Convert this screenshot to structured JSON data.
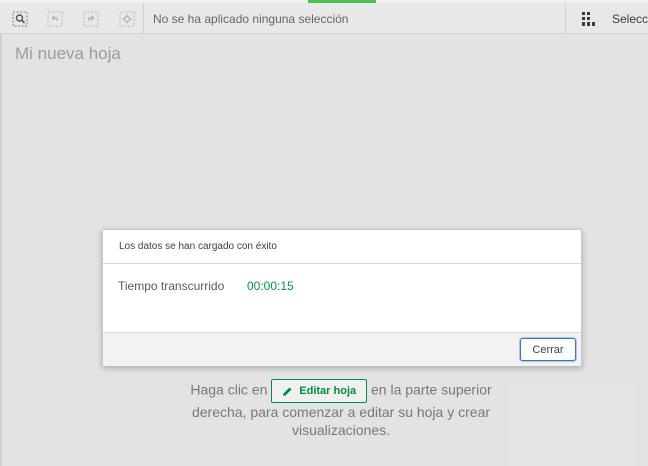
{
  "toolbar": {
    "tools": [
      "smart-search-icon",
      "step-back-icon",
      "step-forward-icon",
      "clear-all-icon"
    ],
    "selection_text": "No se ha aplicado ninguna selección",
    "selections_tool_label": "Seleccio"
  },
  "sheet": {
    "title": "Mi nueva hoja",
    "empty_line1_before": "Haga clic en",
    "edit_button_label": "Editar hoja",
    "empty_line1_after": "en la parte superior",
    "empty_line2": "derecha, para comenzar a editar su hoja y crear",
    "empty_line3": "visualizaciones."
  },
  "dialog": {
    "title": "Los datos se han cargado con éxito",
    "elapsed_label": "Tiempo transcurrido",
    "elapsed_value": "00:00:15",
    "close_label": "Cerrar"
  },
  "colors": {
    "accent_green": "#009845",
    "focus_blue": "#337cb6"
  }
}
